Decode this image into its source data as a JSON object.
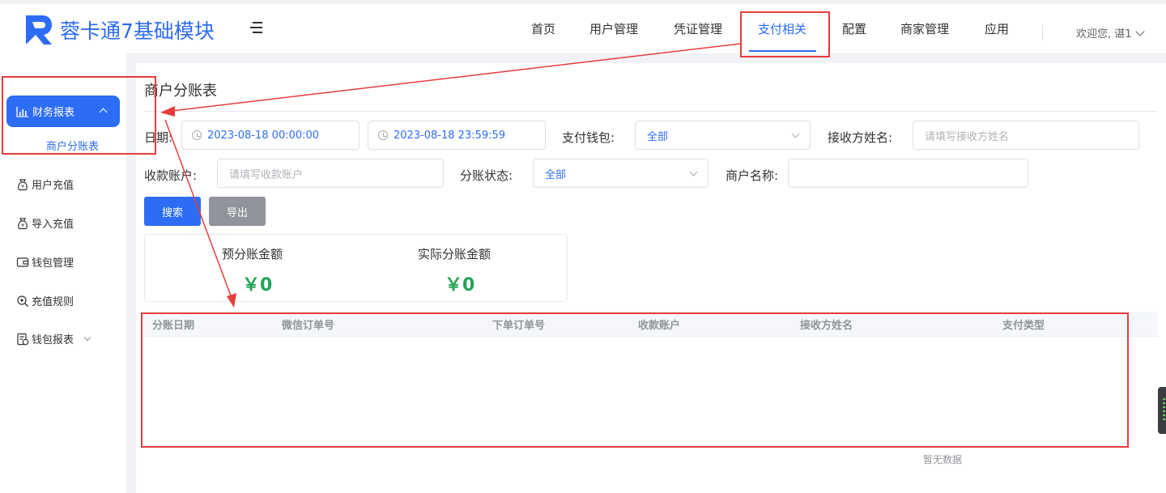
{
  "app": {
    "title": "蓉卡通7基础模块"
  },
  "nav": {
    "items": [
      "首页",
      "用户管理",
      "凭证管理",
      "支付相关",
      "配置",
      "商家管理",
      "应用"
    ],
    "active": "支付相关",
    "welcome": "欢迎您, 谌1"
  },
  "sidebar": {
    "active_group": "财务报表",
    "active_sub": "商户分账表",
    "items": [
      "用户充值",
      "导入充值",
      "钱包管理",
      "充值规则",
      "钱包报表"
    ]
  },
  "page": {
    "title": "商户分账表"
  },
  "filters": {
    "date_label": "日期:",
    "date_start": "2023-08-18 00:00:00",
    "date_end": "2023-08-18 23:59:59",
    "wallet_label": "支付钱包:",
    "wallet_value": "全部",
    "receiver_label": "接收方姓名:",
    "receiver_placeholder": "请填写接收方姓名",
    "account_label": "收款账户:",
    "account_placeholder": "请填写收款账户",
    "status_label": "分账状态:",
    "status_value": "全部",
    "merchant_label": "商户名称:"
  },
  "buttons": {
    "search": "搜索",
    "export": "导出"
  },
  "stats": {
    "expected_label": "预分账金额",
    "expected_value": "￥0",
    "actual_label": "实际分账金额",
    "actual_value": "￥0"
  },
  "table": {
    "columns": [
      "分账日期",
      "微信订单号",
      "下单订单号",
      "收款账户",
      "接收方姓名",
      "支付类型"
    ],
    "empty_text": "暂无数据"
  },
  "colors": {
    "primary": "#2d6cf5",
    "success": "#23a35a",
    "annotation": "#e83c3c"
  }
}
